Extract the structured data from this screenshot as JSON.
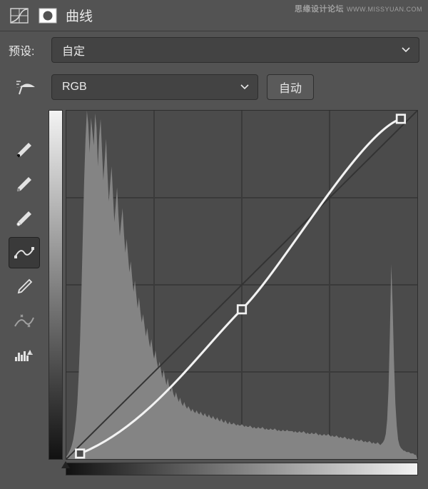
{
  "watermark": {
    "text1": "思缘设计论坛",
    "text2": "WWW.MISSYUAN.COM"
  },
  "header": {
    "title": "曲线"
  },
  "preset": {
    "label": "预设:",
    "value": "自定"
  },
  "channel": {
    "value": "RGB",
    "auto_label": "自动"
  },
  "icons": {
    "curves": "curves-adjustment-icon",
    "mask": "mask-icon",
    "finger": "target-adjust-icon",
    "eyedrop_black": "eyedropper-black-icon",
    "eyedrop_gray": "eyedropper-gray-icon",
    "eyedrop_white": "eyedropper-white-icon",
    "curve_tool": "curve-point-tool-icon",
    "pencil": "pencil-tool-icon",
    "smooth": "smooth-curve-icon",
    "clip": "histogram-clip-icon"
  },
  "chart_data": {
    "type": "line",
    "title": "曲线",
    "xlabel": "",
    "ylabel": "",
    "xlim": [
      0,
      255
    ],
    "ylim": [
      0,
      255
    ],
    "series": [
      {
        "name": "baseline",
        "x": [
          0,
          255
        ],
        "y": [
          0,
          255
        ]
      },
      {
        "name": "curve",
        "points": [
          {
            "x": 10,
            "y": 4
          },
          {
            "x": 128,
            "y": 110
          },
          {
            "x": 244,
            "y": 250
          }
        ]
      }
    ],
    "histogram": [
      2,
      3,
      5,
      7,
      10,
      14,
      20,
      28,
      40,
      60,
      85,
      120,
      160,
      200,
      230,
      250,
      240,
      220,
      245,
      235,
      225,
      248,
      238,
      210,
      232,
      244,
      222,
      200,
      215,
      230,
      205,
      185,
      198,
      210,
      190,
      170,
      182,
      195,
      175,
      160,
      170,
      180,
      162,
      148,
      158,
      146,
      134,
      142,
      130,
      120,
      128,
      118,
      108,
      116,
      106,
      98,
      104,
      96,
      88,
      94,
      86,
      80,
      86,
      78,
      72,
      78,
      70,
      65,
      70,
      64,
      58,
      64,
      58,
      53,
      58,
      52,
      48,
      52,
      47,
      44,
      48,
      44,
      41,
      44,
      40,
      38,
      41,
      38,
      36,
      38,
      36,
      34,
      36,
      34,
      33,
      35,
      33,
      32,
      34,
      32,
      31,
      33,
      31,
      30,
      32,
      30,
      29,
      31,
      29,
      28,
      30,
      28,
      27,
      29,
      27,
      26,
      28,
      26,
      25,
      27,
      25,
      25,
      26,
      25,
      24,
      25,
      24,
      24,
      25,
      24,
      23,
      24,
      23,
      23,
      24,
      23,
      22,
      23,
      22,
      22,
      23,
      22,
      22,
      23,
      22,
      21,
      22,
      21,
      21,
      22,
      21,
      21,
      22,
      21,
      20,
      21,
      20,
      20,
      21,
      20,
      20,
      21,
      20,
      20,
      20,
      20,
      19,
      20,
      19,
      19,
      20,
      19,
      19,
      20,
      19,
      18,
      19,
      18,
      18,
      19,
      18,
      18,
      19,
      18,
      17,
      18,
      17,
      17,
      18,
      17,
      17,
      18,
      17,
      16,
      17,
      16,
      16,
      17,
      16,
      15,
      16,
      15,
      15,
      16,
      15,
      14,
      15,
      14,
      14,
      15,
      14,
      13,
      14,
      13,
      13,
      14,
      13,
      12,
      13,
      12,
      12,
      13,
      12,
      11,
      12,
      11,
      11,
      12,
      11,
      10,
      11,
      12,
      14,
      18,
      28,
      50,
      90,
      140,
      110,
      70,
      40,
      24,
      14,
      10,
      8,
      7,
      6,
      6,
      5,
      5,
      5,
      4,
      4,
      4,
      3,
      3
    ]
  }
}
